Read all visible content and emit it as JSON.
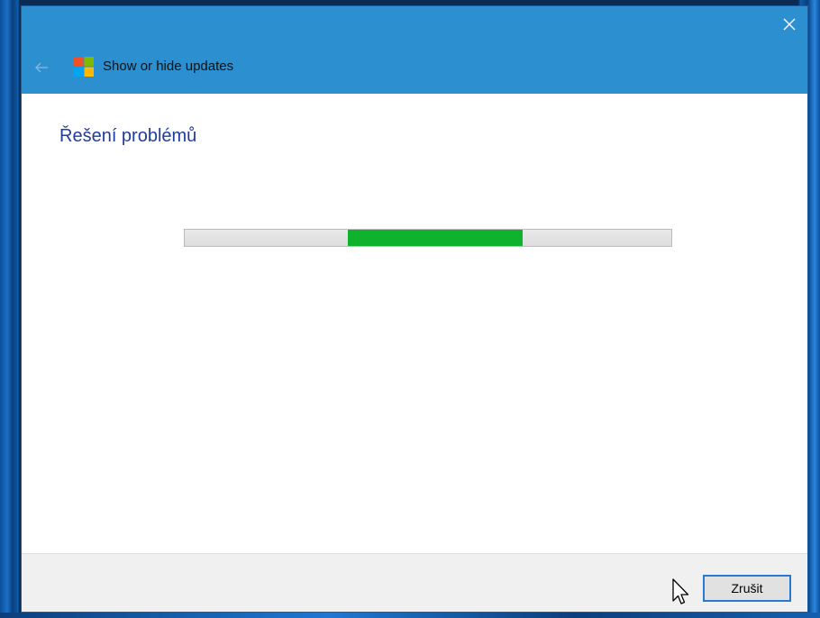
{
  "window": {
    "title": "Show or hide updates",
    "titlebar_color": "#2b8fd0"
  },
  "icons": {
    "close": "close-icon",
    "back": "back-arrow-icon",
    "app": "windows-logo-icon",
    "cursor": "mouse-pointer-icon"
  },
  "content": {
    "heading": "Řešení problémů",
    "heading_color": "#1f3d9a"
  },
  "progress": {
    "kind": "indeterminate-marquee",
    "segment_start": 0.335,
    "segment_end": 0.695,
    "fill_color": "#0fb22d"
  },
  "footer": {
    "cancel_label": "Zrušit"
  }
}
